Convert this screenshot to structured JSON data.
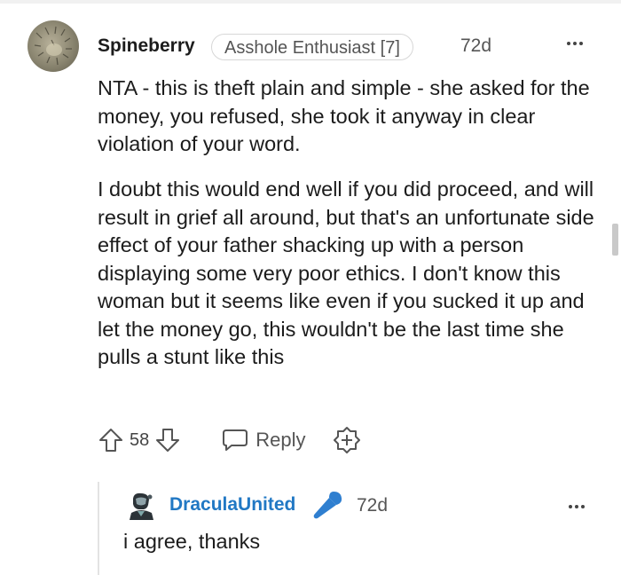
{
  "comment": {
    "username": "Spineberry",
    "flair": "Asshole Enthusiast [7]",
    "time": "72d",
    "paragraphs": [
      "NTA - this is theft plain and simple - she asked for the money, you refused, she took it anyway in clear violation of your word.",
      "I doubt this would end well if you did proceed, and will result in grief all around, but that's an unfortunate side effect of your father shacking up with a person displaying some very poor ethics. I don't know this woman but it seems like even if you sucked it up and let the money go, this wouldn't be the last time she pulls a stunt like this"
    ],
    "score": "58",
    "reply_label": "Reply"
  },
  "reply": {
    "username": "DraculaUnited",
    "time": "72d",
    "text": "i agree, thanks"
  },
  "icons": {
    "upvote": "upvote-arrow-icon",
    "downvote": "downvote-arrow-icon",
    "reply": "speech-bubble-icon",
    "award": "award-plus-icon",
    "more": "more-dots-icon",
    "op": "microphone-icon"
  },
  "colors": {
    "op_username": "#2178c4",
    "mic": "#2f7fd0"
  }
}
